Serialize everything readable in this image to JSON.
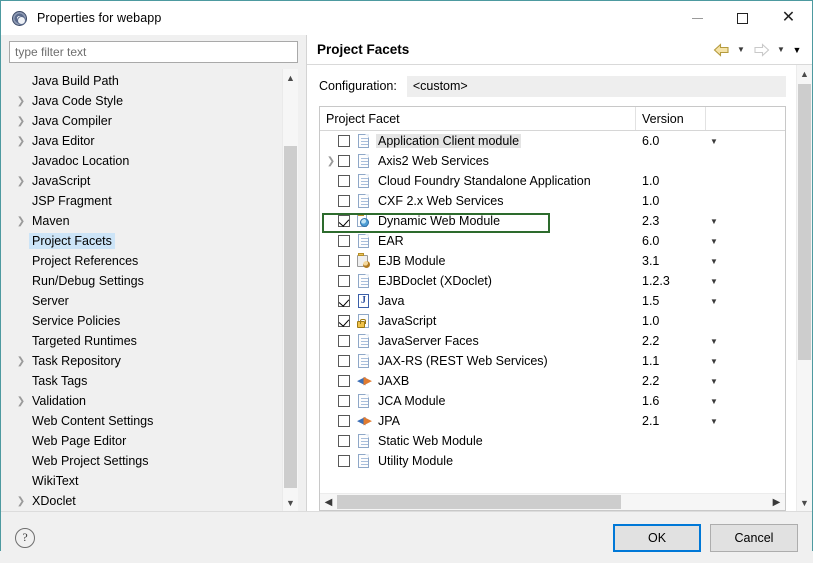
{
  "window": {
    "title": "Properties for webapp",
    "app_icon": "gear-icon",
    "controls": {
      "minimize": "minimize-icon",
      "maximize": "maximize-icon",
      "close": "close-icon"
    }
  },
  "sidebar": {
    "filter": {
      "placeholder": "type filter text",
      "value": ""
    },
    "items": [
      {
        "label": "Java Build Path",
        "expandable": false,
        "selected": false
      },
      {
        "label": "Java Code Style",
        "expandable": true,
        "selected": false
      },
      {
        "label": "Java Compiler",
        "expandable": true,
        "selected": false
      },
      {
        "label": "Java Editor",
        "expandable": true,
        "selected": false
      },
      {
        "label": "Javadoc Location",
        "expandable": false,
        "selected": false
      },
      {
        "label": "JavaScript",
        "expandable": true,
        "selected": false
      },
      {
        "label": "JSP Fragment",
        "expandable": false,
        "selected": false
      },
      {
        "label": "Maven",
        "expandable": true,
        "selected": false
      },
      {
        "label": "Project Facets",
        "expandable": false,
        "selected": true
      },
      {
        "label": "Project References",
        "expandable": false,
        "selected": false
      },
      {
        "label": "Run/Debug Settings",
        "expandable": false,
        "selected": false
      },
      {
        "label": "Server",
        "expandable": false,
        "selected": false
      },
      {
        "label": "Service Policies",
        "expandable": false,
        "selected": false
      },
      {
        "label": "Targeted Runtimes",
        "expandable": false,
        "selected": false
      },
      {
        "label": "Task Repository",
        "expandable": true,
        "selected": false
      },
      {
        "label": "Task Tags",
        "expandable": false,
        "selected": false
      },
      {
        "label": "Validation",
        "expandable": true,
        "selected": false
      },
      {
        "label": "Web Content Settings",
        "expandable": false,
        "selected": false
      },
      {
        "label": "Web Page Editor",
        "expandable": false,
        "selected": false
      },
      {
        "label": "Web Project Settings",
        "expandable": false,
        "selected": false
      },
      {
        "label": "WikiText",
        "expandable": false,
        "selected": false
      },
      {
        "label": "XDoclet",
        "expandable": true,
        "selected": false
      }
    ]
  },
  "page": {
    "title": "Project Facets",
    "nav": {
      "back": "back-arrow-icon",
      "back_caret": "chevron-down-icon",
      "forward": "forward-arrow-icon",
      "forward_caret": "chevron-down-icon",
      "menu_caret": "chevron-down-icon"
    },
    "configuration": {
      "label": "Configuration:",
      "value": "<custom>"
    },
    "table": {
      "columns": [
        "Project Facet",
        "Version"
      ],
      "rows": [
        {
          "facet": "Application Client module",
          "version": "6.0",
          "checked": false,
          "expandable": false,
          "icon": "document-icon",
          "has_version_dropdown": true,
          "name_highlight": true
        },
        {
          "facet": "Axis2 Web Services",
          "version": "",
          "checked": false,
          "expandable": true,
          "icon": "document-icon",
          "has_version_dropdown": false,
          "name_highlight": false
        },
        {
          "facet": "Cloud Foundry Standalone Application",
          "version": "1.0",
          "checked": false,
          "expandable": false,
          "icon": "document-icon",
          "has_version_dropdown": false,
          "name_highlight": false
        },
        {
          "facet": "CXF 2.x Web Services",
          "version": "1.0",
          "checked": false,
          "expandable": false,
          "icon": "document-icon",
          "has_version_dropdown": false,
          "name_highlight": false
        },
        {
          "facet": "Dynamic Web Module",
          "version": "2.3",
          "checked": true,
          "expandable": false,
          "icon": "web-module-icon",
          "has_version_dropdown": true,
          "highlighted": true,
          "name_highlight": false
        },
        {
          "facet": "EAR",
          "version": "6.0",
          "checked": false,
          "expandable": false,
          "icon": "document-icon",
          "has_version_dropdown": true,
          "name_highlight": false
        },
        {
          "facet": "EJB Module",
          "version": "3.1",
          "checked": false,
          "expandable": false,
          "icon": "ejb-icon",
          "has_version_dropdown": true,
          "name_highlight": false
        },
        {
          "facet": "EJBDoclet (XDoclet)",
          "version": "1.2.3",
          "checked": false,
          "expandable": false,
          "icon": "document-icon",
          "has_version_dropdown": true,
          "name_highlight": false
        },
        {
          "facet": "Java",
          "version": "1.5",
          "checked": true,
          "expandable": false,
          "icon": "java-icon",
          "has_version_dropdown": true,
          "name_highlight": false
        },
        {
          "facet": "JavaScript",
          "version": "1.0",
          "checked": true,
          "expandable": false,
          "icon": "javascript-lock-icon",
          "has_version_dropdown": false,
          "name_highlight": false
        },
        {
          "facet": "JavaServer Faces",
          "version": "2.2",
          "checked": false,
          "expandable": false,
          "icon": "document-icon",
          "has_version_dropdown": true,
          "name_highlight": false
        },
        {
          "facet": "JAX-RS (REST Web Services)",
          "version": "1.1",
          "checked": false,
          "expandable": false,
          "icon": "document-icon",
          "has_version_dropdown": true,
          "name_highlight": false
        },
        {
          "facet": "JAXB",
          "version": "2.2",
          "checked": false,
          "expandable": false,
          "icon": "arrows-icon",
          "has_version_dropdown": true,
          "name_highlight": false
        },
        {
          "facet": "JCA Module",
          "version": "1.6",
          "checked": false,
          "expandable": false,
          "icon": "document-icon",
          "has_version_dropdown": true,
          "name_highlight": false
        },
        {
          "facet": "JPA",
          "version": "2.1",
          "checked": false,
          "expandable": false,
          "icon": "arrows-icon",
          "has_version_dropdown": true,
          "name_highlight": false
        },
        {
          "facet": "Static Web Module",
          "version": "",
          "checked": false,
          "expandable": false,
          "icon": "document-icon",
          "has_version_dropdown": false,
          "name_highlight": false
        },
        {
          "facet": "Utility Module",
          "version": "",
          "checked": false,
          "expandable": false,
          "icon": "document-icon",
          "has_version_dropdown": false,
          "name_highlight": false
        }
      ]
    }
  },
  "footer": {
    "help": "help-icon",
    "ok_label": "OK",
    "cancel_label": "Cancel"
  },
  "colors": {
    "selection": "#cce4f7",
    "highlight_border": "#2d6b2d",
    "primary_button_border": "#0078d7",
    "window_border": "#4d9aa0"
  }
}
